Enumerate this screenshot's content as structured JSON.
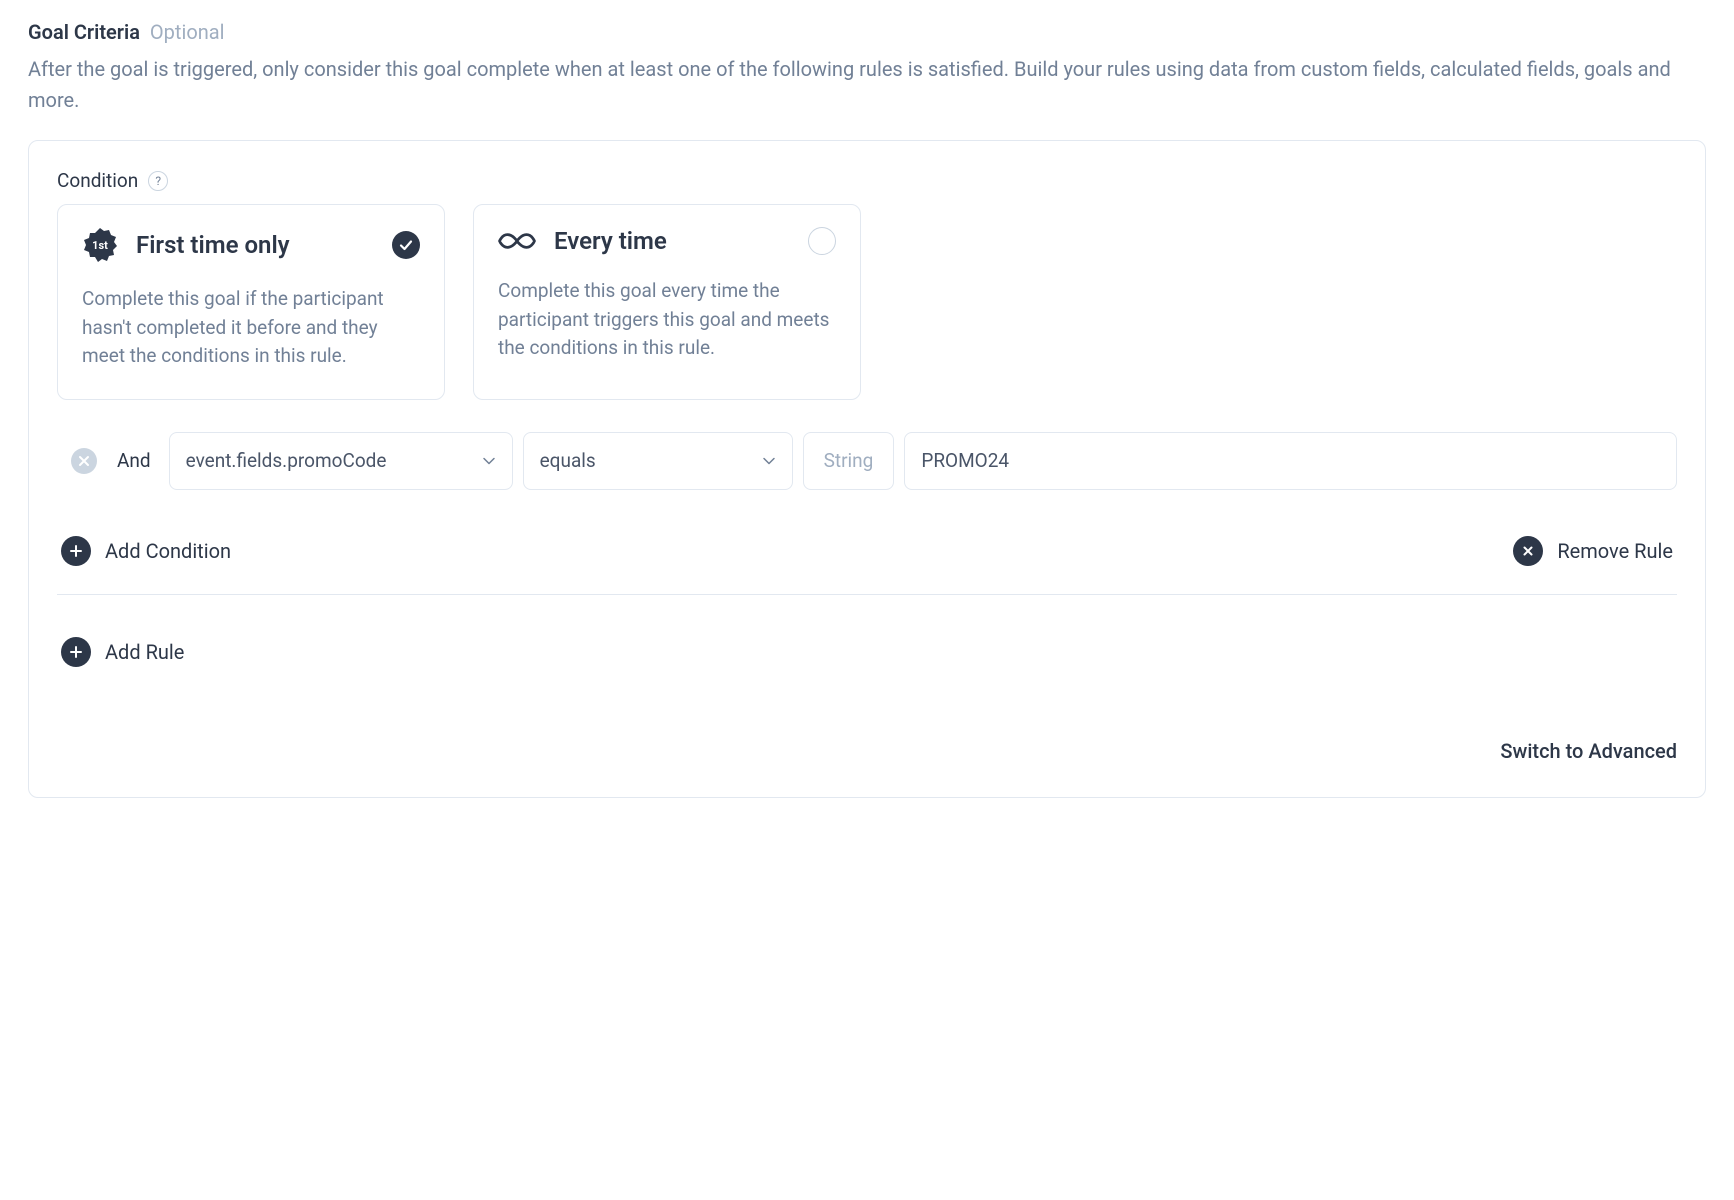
{
  "header": {
    "title": "Goal Criteria",
    "optional": "Optional",
    "description": "After the goal is triggered, only consider this goal complete when at least one of the following rules is satisfied. Build your rules using data from custom fields, calculated fields, goals and more."
  },
  "condition": {
    "label": "Condition",
    "options": [
      {
        "title": "First time only",
        "description": "Complete this goal if the participant hasn't completed it before and they meet the conditions in this rule.",
        "selected": true,
        "icon": "badge-1st"
      },
      {
        "title": "Every time",
        "description": "Complete this goal every time the participant triggers this goal and meets the conditions in this rule.",
        "selected": false,
        "icon": "infinity"
      }
    ]
  },
  "rule": {
    "operator_join": "And",
    "field": "event.fields.promoCode",
    "comparator": "equals",
    "type": "String",
    "value": "PROMO24"
  },
  "actions": {
    "add_condition": "Add Condition",
    "remove_rule": "Remove Rule",
    "add_rule": "Add Rule",
    "switch_advanced": "Switch to Advanced"
  }
}
